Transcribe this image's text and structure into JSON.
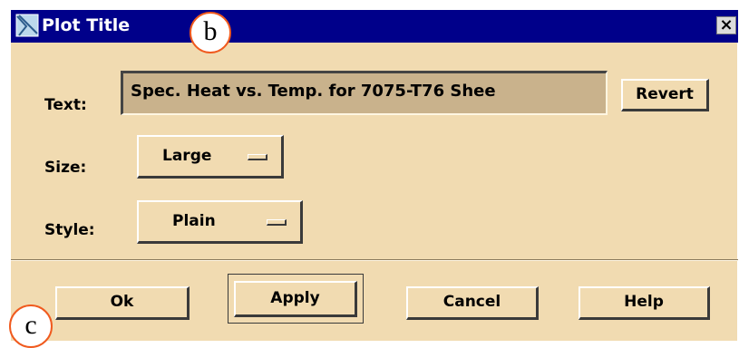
{
  "window": {
    "title": "Plot Title",
    "close_symbol": "×",
    "title_icon": "plot-icon"
  },
  "callouts": {
    "b": "b",
    "c": "c"
  },
  "form": {
    "text_label": "Text:",
    "text_value": "Spec. Heat vs. Temp. for 7075-T76 Shee",
    "revert_label": "Revert",
    "size_label": "Size:",
    "size_value": "Large",
    "style_label": "Style:",
    "style_value": "Plain"
  },
  "buttons": {
    "ok": "Ok",
    "apply": "Apply",
    "cancel": "Cancel",
    "help": "Help"
  },
  "colors": {
    "titlebar": "#00008a",
    "dialog_bg": "#f1dbb1",
    "field_bg": "#c9b28c",
    "callout_border": "#f05a1e"
  }
}
